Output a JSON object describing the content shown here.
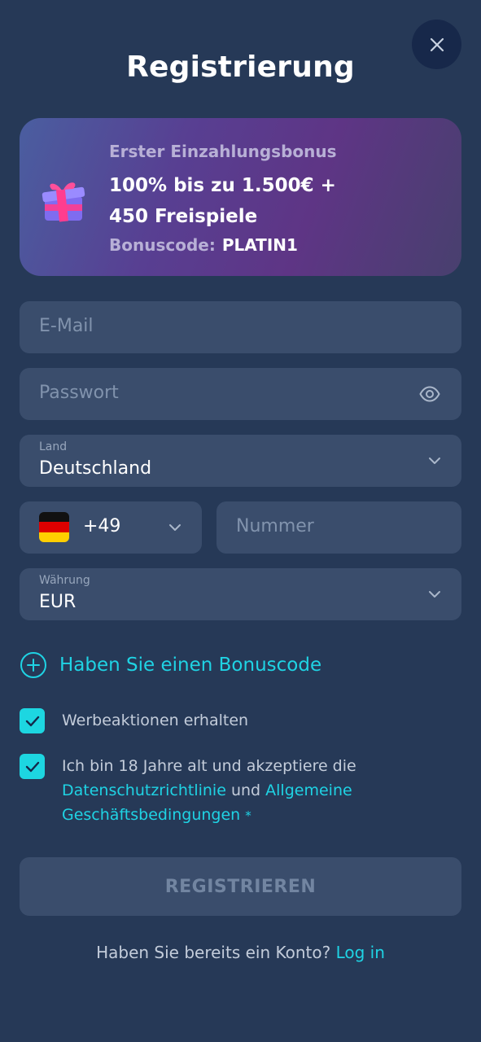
{
  "header": {
    "title": "Registrierung",
    "close_icon": "close-icon"
  },
  "bonus": {
    "subtitle": "Erster Einzahlungsbonus",
    "headline": "100% bis zu 1.500€ + 450 Freispiele",
    "code_label": "Bonuscode:",
    "code_value": "PLATIN1",
    "icon": "gift-icon"
  },
  "form": {
    "email": {
      "placeholder": "E-Mail",
      "value": ""
    },
    "password": {
      "placeholder": "Passwort",
      "value": "",
      "icon": "eye-icon"
    },
    "country": {
      "label": "Land",
      "value": "Deutschland"
    },
    "phone": {
      "dial_code": "+49",
      "flag": "germany-flag",
      "placeholder": "Nummer",
      "value": ""
    },
    "currency": {
      "label": "Währung",
      "value": "EUR"
    },
    "bonus_code_link": "Haben Sie einen Bonuscode"
  },
  "consents": {
    "promotions": {
      "label": "Werbeaktionen erhalten",
      "checked": true
    },
    "terms": {
      "text_before": "Ich bin 18 Jahre alt und akzeptiere die",
      "privacy_link": "Datenschutzrichtlinie",
      "conjunction": "und",
      "terms_link": "Allgemeine Geschäftsbedingungen",
      "required_mark": "*",
      "checked": true
    }
  },
  "submit_label": "REGISTRIEREN",
  "footer": {
    "question": "Haben Sie bereits ein Konto?",
    "login_link": "Log in"
  },
  "colors": {
    "background": "#263957",
    "field": "#3a4d6c",
    "accent": "#1fd3e4",
    "close_button": "#17284a"
  }
}
